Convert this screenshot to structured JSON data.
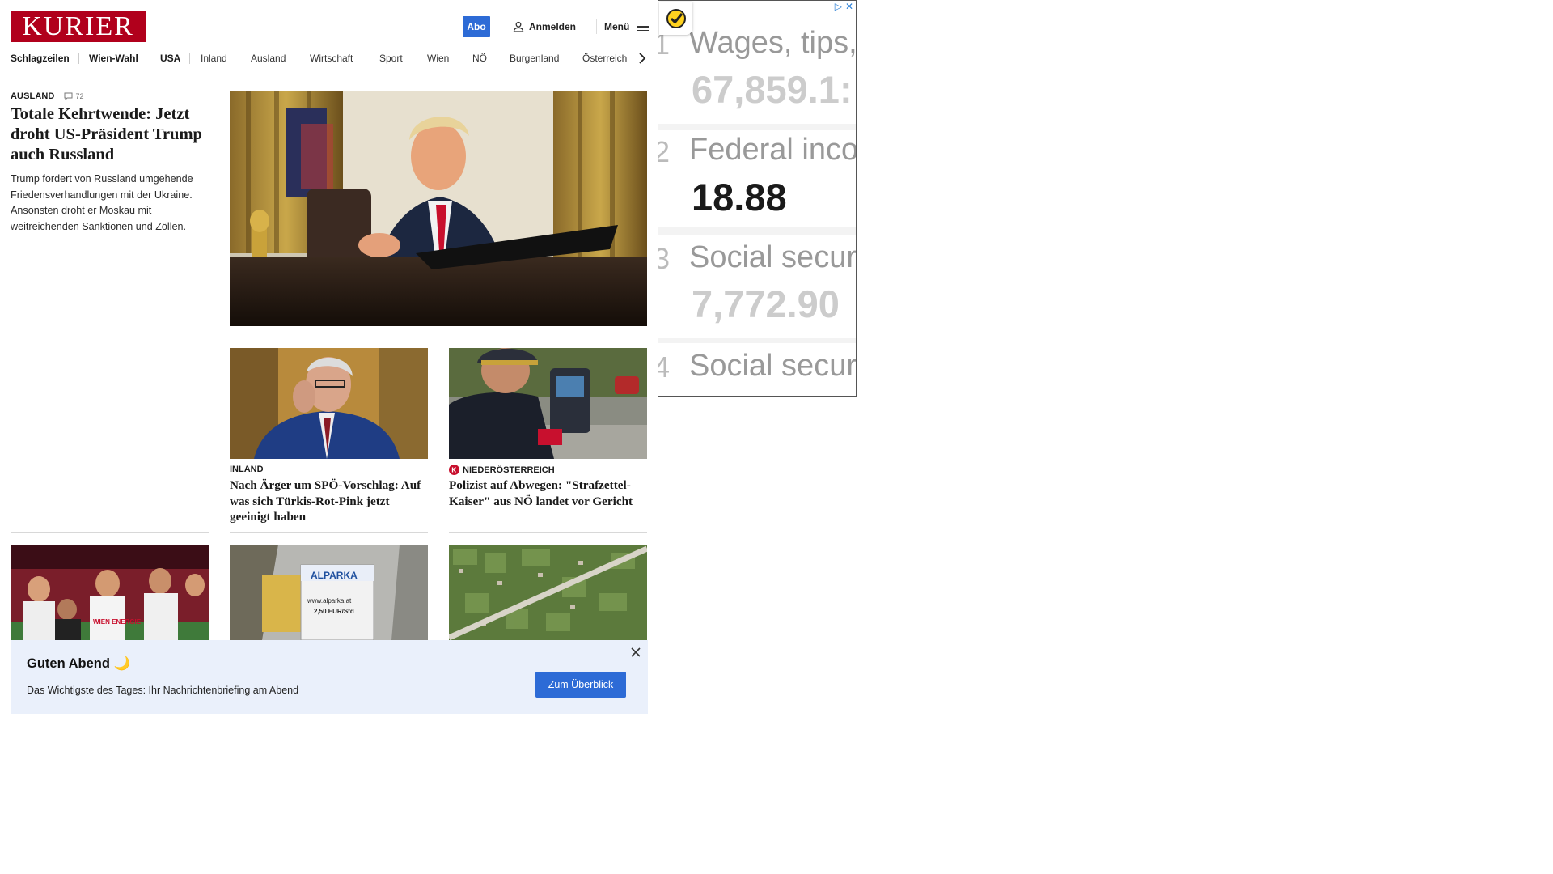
{
  "header": {
    "logo": "KURIER",
    "abo": "Abo",
    "login": "Anmelden",
    "menu": "Menü"
  },
  "nav": {
    "items": [
      "Schlagzeilen",
      "Wien-Wahl",
      "USA",
      "Inland",
      "Ausland",
      "Wirtschaft",
      "Sport",
      "Wien",
      "NÖ",
      "Burgenland",
      "Österreich"
    ]
  },
  "lead": {
    "kicker": "AUSLAND",
    "comments": "72",
    "title": "Totale Kehrtwende: Jetzt droht US-Präsident Trump auch Russland",
    "teaser": "Trump fordert von Russland umgehende Friedensverhandlungen mit der Ukraine. Ansonsten droht er Moskau mit weitreichenden Sanktionen und Zöllen."
  },
  "cards": [
    {
      "kicker": "INLAND",
      "title": "Nach Ärger um SPÖ-Vorschlag: Auf was sich Türkis-Rot-Pink jetzt geeinigt haben"
    },
    {
      "kicker": "NIEDERÖSTERREICH",
      "title": "Polizist auf Abwegen: \"Strafzettel-Kaiser\" aus NÖ landet vor Gericht"
    }
  ],
  "photos": {
    "jersey_text": "WIEN ENERGIE",
    "sign_brand": "ALPARKA",
    "sign_url": "www.alparka.at",
    "sign_price": "2,50 EUR/Std"
  },
  "ad": {
    "rows": [
      {
        "num": "1",
        "label": "Wages, tips,",
        "value": "67,859.1:"
      },
      {
        "num": "2",
        "label": "Federal inco",
        "value": "18.88"
      },
      {
        "num": "3",
        "label": "Social secur",
        "value": "7,772.90"
      },
      {
        "num": "4",
        "label": "Social secur",
        "value": ""
      }
    ],
    "adchoices": "▷",
    "close": "✕"
  },
  "banner": {
    "title": "Guten Abend 🌙",
    "text": "Das Wichtigste des Tages: Ihr Nachrichtenbriefing am Abend",
    "button": "Zum Überblick"
  },
  "colors": {
    "brand": "#b1001c",
    "accent": "#2d6bd6",
    "banner_bg": "#eaf0fb"
  }
}
